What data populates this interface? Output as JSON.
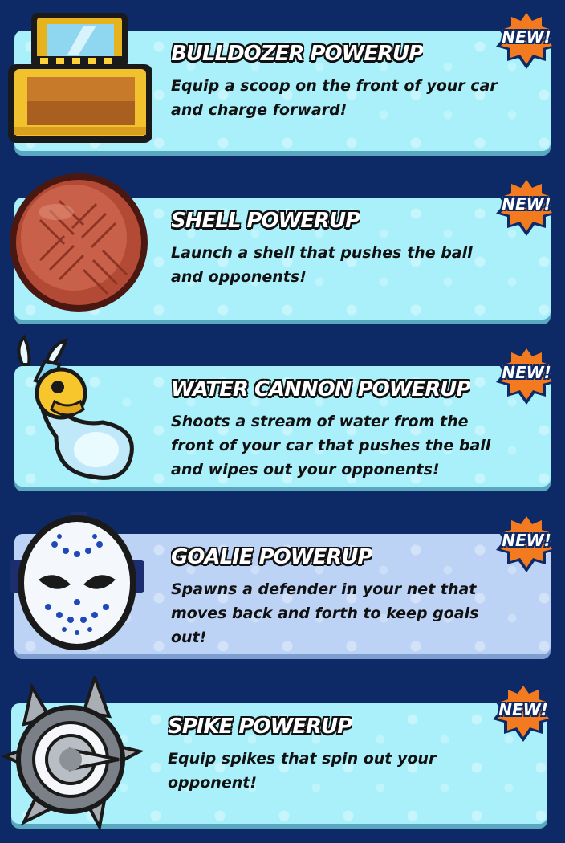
{
  "badge_label": "NEW!",
  "powerups": [
    {
      "title": "BULLDOZER POWERUP",
      "description": "Equip a scoop on the front of your car and charge forward!",
      "icon": "bulldozer-icon"
    },
    {
      "title": "SHELL POWERUP",
      "description": "Launch a shell that pushes the ball and opponents!",
      "icon": "shell-icon"
    },
    {
      "title": "WATER CANNON POWERUP",
      "description": "Shoots a stream of water from the front of your car that pushes the ball and wipes out your opponents!",
      "icon": "water-cannon-icon"
    },
    {
      "title": "GOALIE POWERUP",
      "description": "Spawns a defender in your net that moves back and forth to keep goals out!",
      "icon": "goalie-mask-icon"
    },
    {
      "title": "SPIKE POWERUP",
      "description": "Equip spikes that spin out your opponent!",
      "icon": "spike-ball-icon"
    }
  ],
  "colors": {
    "background": "#0e2a66",
    "card": "#a9f0fb",
    "card_alt": "#bcd3f5",
    "badge": "#f37a1f"
  }
}
